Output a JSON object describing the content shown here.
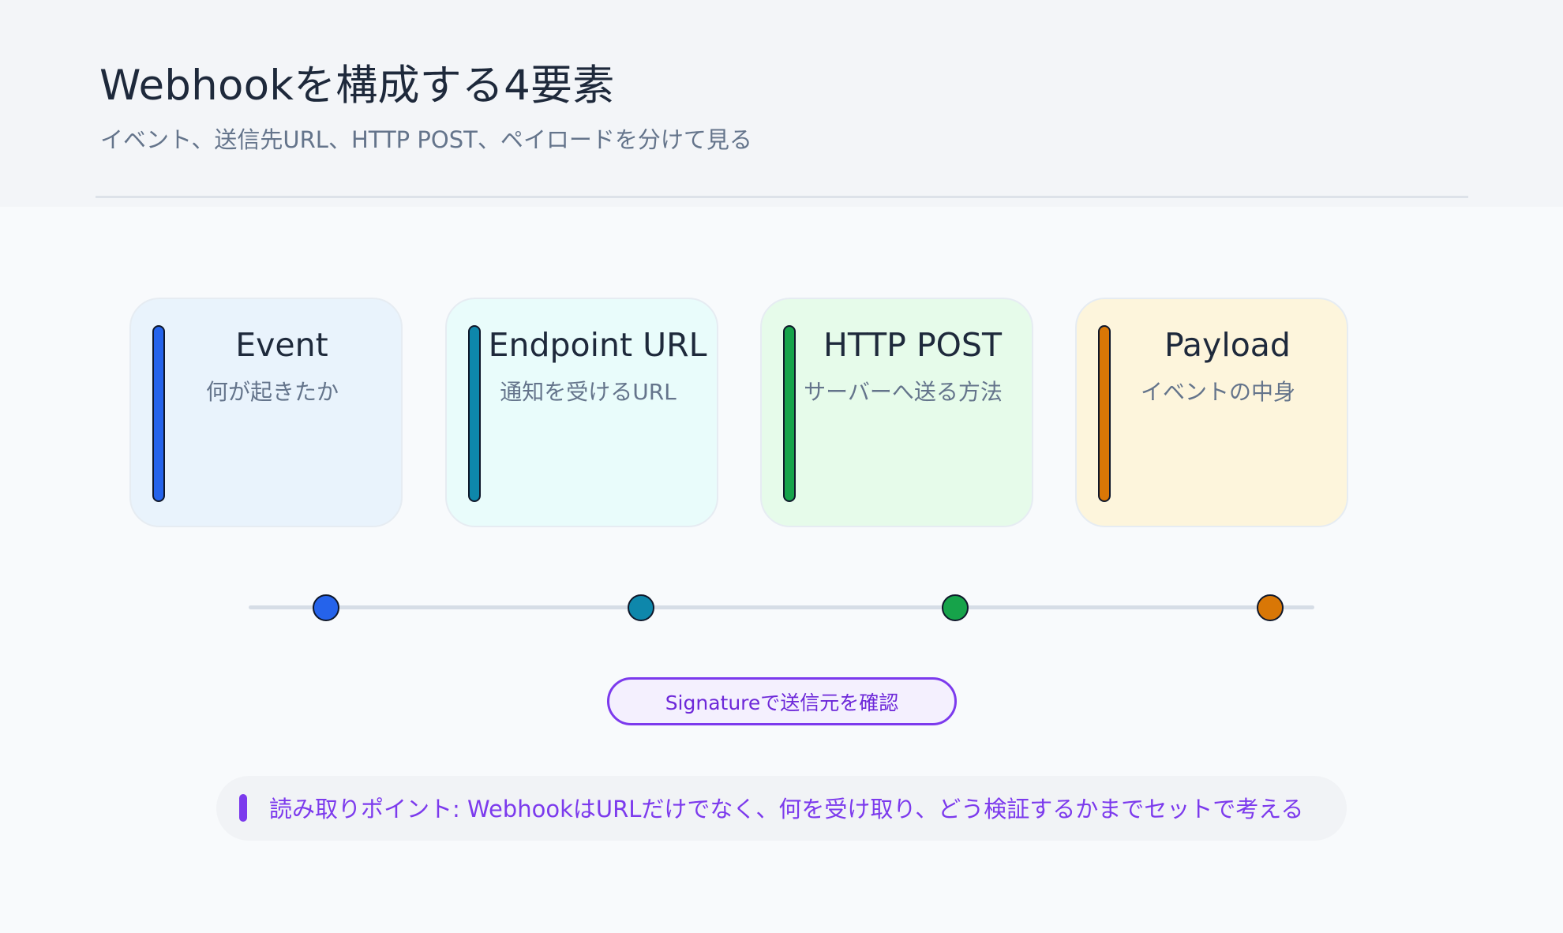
{
  "header": {
    "title": "Webhookを構成する4要素",
    "subtitle": "イベント、送信先URL、HTTP POST、ペイロードを分けて見る"
  },
  "components": [
    {
      "title": "Event",
      "description": "何が起きたか",
      "color": "#2563eb",
      "bg": "#e9f3fc"
    },
    {
      "title": "Endpoint URL",
      "description": "通知を受けるURL",
      "color": "#0e87ab",
      "bg": "#e9fcfb"
    },
    {
      "title": "HTTP POST",
      "description": "サーバーへ送る方法",
      "color": "#16a34a",
      "bg": "#e6fbea"
    },
    {
      "title": "Payload",
      "description": "イベントの中身",
      "color": "#d97706",
      "bg": "#fdf5dc"
    }
  ],
  "signature": {
    "label": "Signatureで送信元を確認",
    "color": "#7c3aed"
  },
  "note": {
    "text": "読み取りポイント: WebhookはURLだけでなく、何を受け取り、どう検証するかまでセットで考える"
  }
}
